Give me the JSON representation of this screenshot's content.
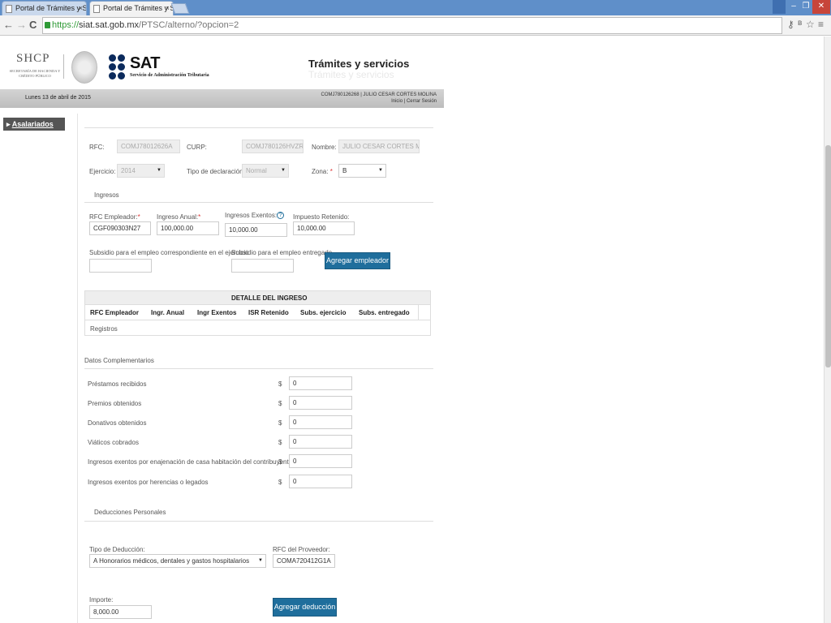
{
  "browser": {
    "tabs": [
      {
        "title": "Portal de Trámites y Serv"
      },
      {
        "title": "Portal de Trámites y Serv"
      }
    ],
    "close_glyph": "×",
    "nav": {
      "back": "←",
      "forward": "→",
      "reload": "C"
    },
    "url_scheme": "https://",
    "url_host": "siat.sat.gob.mx",
    "url_path": "/PTSC/alterno/?opcion=2",
    "window_buttons": {
      "minimize": "–",
      "restore": "❐",
      "close": "✕"
    },
    "icons": [
      "key-icon",
      "translate-icon",
      "star-icon",
      "menu-icon"
    ]
  },
  "header": {
    "shcp": "SHCP",
    "shcp_sub": "SECRETARÍA DE HACIENDA Y CRÉDITO PÚBLICO",
    "sat": "SAT",
    "sat_sub": "Servicio de Administración Tributaria",
    "title": "Trámites y servicios",
    "title_ghost": "Trámites y servicios"
  },
  "infobar": {
    "date": "Lunes 13 de abril de 2015",
    "user": "COMJ780126268 | JULIO CESAR CORTES MOLINA",
    "links": "Inicio | Cerrar Sesión"
  },
  "sidebar": {
    "items": [
      {
        "label": "Asalariados",
        "bullet": "▸"
      }
    ]
  },
  "form": {
    "rfc_label": "RFC:",
    "rfc_value": "COMJ78012626A",
    "curp_label": "CURP:",
    "curp_value": "COMJ780126HVZRLL08",
    "nombre_label": "Nombre:",
    "nombre_value": "JULIO CESAR CORTES MOLINA",
    "ejercicio_label": "Ejercicio:",
    "ejercicio_value": "2014",
    "tipo_label": "Tipo de declaración:",
    "tipo_value": "Normal",
    "zona_label": "Zona:",
    "zona_value": "B",
    "required_mark": "*",
    "select_arrow": "▼"
  },
  "ingresos": {
    "section": "Ingresos",
    "rfc_emp_label": "RFC Empleador:",
    "rfc_emp_value": "CGF090303N27",
    "anual_label": "Ingreso Anual:",
    "anual_value": "100,000.00",
    "exentos_label": "Ingresos Exentos:",
    "exentos_value": "10,000.00",
    "help": "?",
    "retenido_label": "Impuesto Retenido:",
    "retenido_value": "10,000.00",
    "subsidio_ej_label": "Subsidio para el empleo correspondiente en el ejercicio",
    "subsidio_ent_label": "Subsidio para el empleo entregado",
    "agregar_empleador": "Agregar empleador"
  },
  "detalle": {
    "title": "DETALLE DEL INGRESO",
    "columns": [
      "RFC Empleador",
      "Ingr. Anual",
      "Ingr Exentos",
      "ISR Retenido",
      "Subs. ejercicio",
      "Subs. entregado"
    ],
    "empty_row": "Registros"
  },
  "complementarios": {
    "section": "Datos Complementarios",
    "currency": "$",
    "rows": [
      {
        "label": "Préstamos recibidos",
        "value": "0"
      },
      {
        "label": "Premios obtenidos",
        "value": "0"
      },
      {
        "label": "Donativos obtenidos",
        "value": "0"
      },
      {
        "label": "Viáticos cobrados",
        "value": "0"
      },
      {
        "label": "Ingresos exentos por enajenación de casa habitación del contribuyente",
        "value": "0"
      },
      {
        "label": "Ingresos exentos por herencias o legados",
        "value": "0"
      }
    ]
  },
  "deducciones": {
    "section": "Deducciones Personales",
    "tipo_label": "Tipo de Deducción:",
    "tipo_value": "A Honorarios médicos, dentales y gastos hospitalarios",
    "rfc_prov_label": "RFC del Proveedor:",
    "rfc_prov_value": "COMA720412G1A",
    "importe_label": "Importe:",
    "importe_value": "8,000.00",
    "agregar_deduccion": "Agregar deducción"
  },
  "colors": {
    "tabbar": "#5f8fc9",
    "button": "#1f6e9c",
    "sidebar": "#555555"
  }
}
